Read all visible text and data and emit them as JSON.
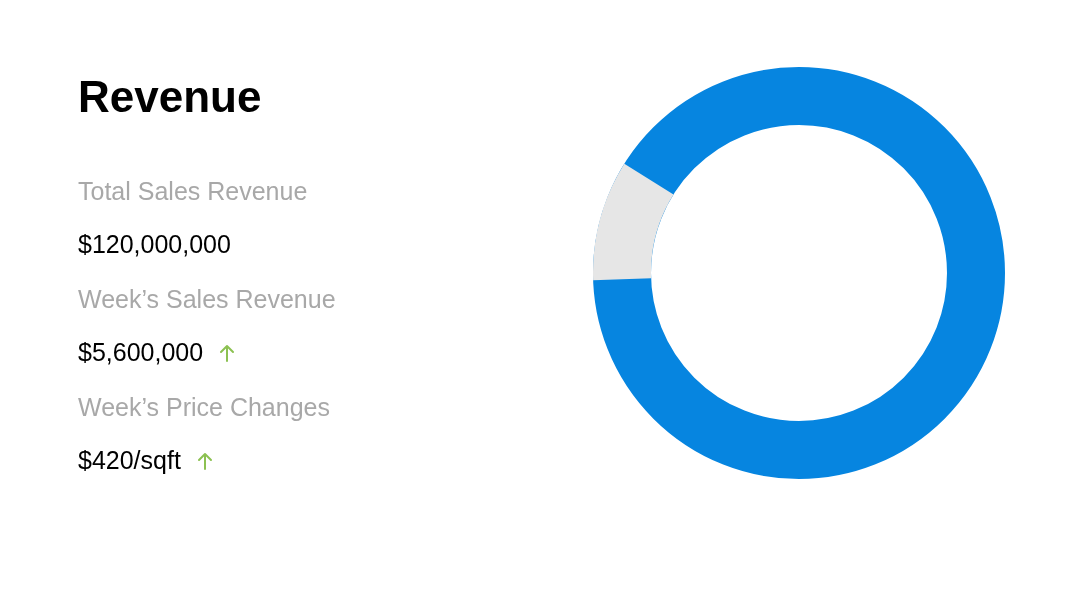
{
  "title": "Revenue",
  "metrics": [
    {
      "label": "Total Sales Revenue",
      "value": "$120,000,000",
      "rising": false
    },
    {
      "label": "Week’s Sales Revenue",
      "value": "$5,600,000",
      "rising": true
    },
    {
      "label": "Week’s Price Changes",
      "value": "$420/sqft",
      "rising": true
    }
  ]
}
